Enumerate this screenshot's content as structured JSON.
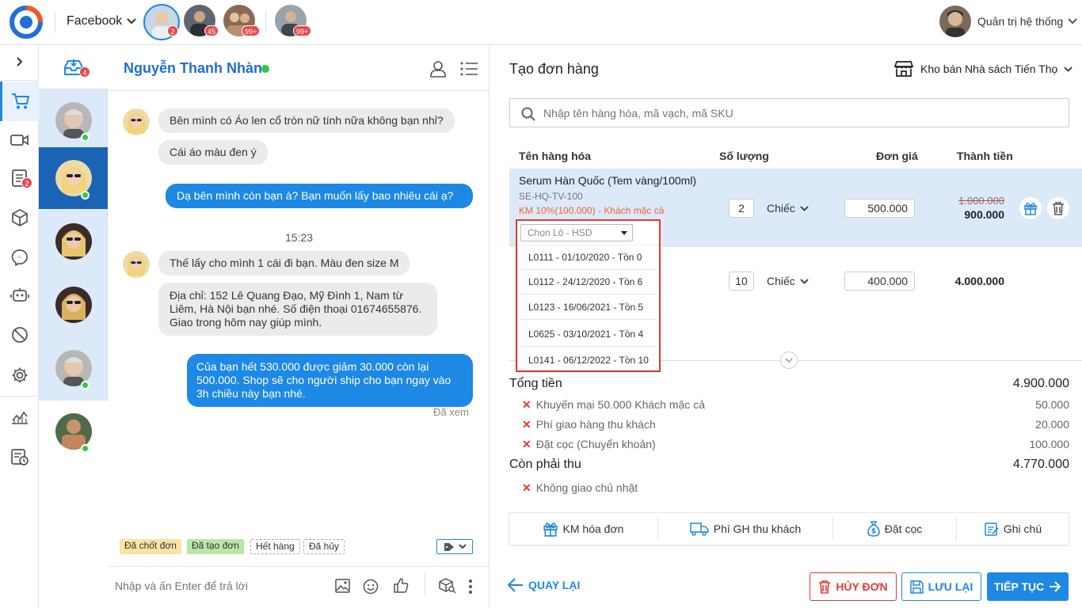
{
  "topbar": {
    "channel": "Facebook",
    "tab_badges": [
      "2",
      "45",
      "99+",
      "99+"
    ],
    "user_name": "Quản trị hệ thống"
  },
  "nav": {
    "inbox_badge": "4",
    "orders_badge": "2"
  },
  "chat": {
    "contact_name": "Nguyễn Thanh Nhàn",
    "messages": [
      {
        "from": "customer",
        "text": "Bên mình có Áo len cổ tròn nữ tính nữa không bạn nhỉ?"
      },
      {
        "from": "customer",
        "text": "Cái áo màu đen ý"
      },
      {
        "from": "shop",
        "text": "Dạ bên mình còn bạn à? Bạn muốn lấy bao nhiêu cái ạ?"
      },
      {
        "from": "customer",
        "text": "Thế lấy cho mình 1 cái đi bạn. Màu đen size M"
      },
      {
        "from": "customer",
        "text": "Địa chỉ: 152 Lê Quang Đạo, Mỹ Đình 1, Nam từ Liêm, Hà Nội bạn nhé. Số điện thoại 01674655876. Giao trong hôm nay giúp mình."
      },
      {
        "from": "shop",
        "text": "Của bạn hết 530.000 được giảm 30.000 còn lại 500.000. Shop sẽ cho người ship cho bạn ngay vào 3h chiều này bạn nhé."
      }
    ],
    "time_divider": "15:23",
    "seen_label": "Đã xem",
    "tags": [
      "Đã chốt đơn",
      "Đã tạo đơn",
      "Hết hàng",
      "Đã hủy"
    ],
    "input_placeholder": "Nhập và ấn Enter để trả lời"
  },
  "order": {
    "title": "Tạo đơn hàng",
    "warehouse": "Kho bán Nhà sách Tiến Thọ",
    "search_placeholder": "Nhập tên hàng hóa, mã vạch, mã SKU",
    "columns": [
      "Tên hàng hóa",
      "Số lượng",
      "Đơn giá",
      "Thành tiền"
    ],
    "items": [
      {
        "name": "Serum Hàn Quốc (Tem vàng/100ml)",
        "sku": "SE-HQ-TV-100",
        "promo": "KM 10%(100.000) - Khách mặc cả",
        "qty": "2",
        "unit": "Chiếc",
        "price": "500.000",
        "old_total": "1.000.000",
        "total": "900.000"
      },
      {
        "qty": "10",
        "unit": "Chiếc",
        "price": "400.000",
        "total": "4.000.000"
      }
    ],
    "lot_select": {
      "placeholder": "Chọn Lô - HSD",
      "options": [
        "L0111 - 01/10/2020 - Tồn 0",
        "L0112 - 24/12/2020 - Tồn 6",
        "L0123 - 16/06/2021 - Tồn 5",
        "L0625 - 03/10/2021 - Tồn 4",
        "L0141 - 06/12/2022 - Tồn 10"
      ]
    },
    "summary": {
      "total_label": "Tổng tiền",
      "total_value": "4.900.000",
      "lines": [
        {
          "label": "Khuyến mại 50.000 Khách mặc cả",
          "value": "50.000"
        },
        {
          "label": "Phí giao hàng thu khách",
          "value": "20.000"
        },
        {
          "label": "Đặt cọc (Chuyển khoản)",
          "value": "100.000"
        }
      ],
      "remaining_label": "Còn phải thu",
      "remaining_value": "4.770.000",
      "note": "Không giao chủ nhật"
    },
    "tools": [
      "KM hóa đơn",
      "Phí GH thu khách",
      "Đặt cọc",
      "Ghi chú"
    ],
    "footer": {
      "back": "QUAY LẠI",
      "cancel": "HỦY ĐƠN",
      "save": "LƯU LẠI",
      "next": "TIẾP TỤC"
    }
  },
  "colors": {
    "primary": "#1e88e5",
    "danger": "#e53935",
    "highlight_row": "#dce9f8",
    "promo": "#f0652f"
  }
}
